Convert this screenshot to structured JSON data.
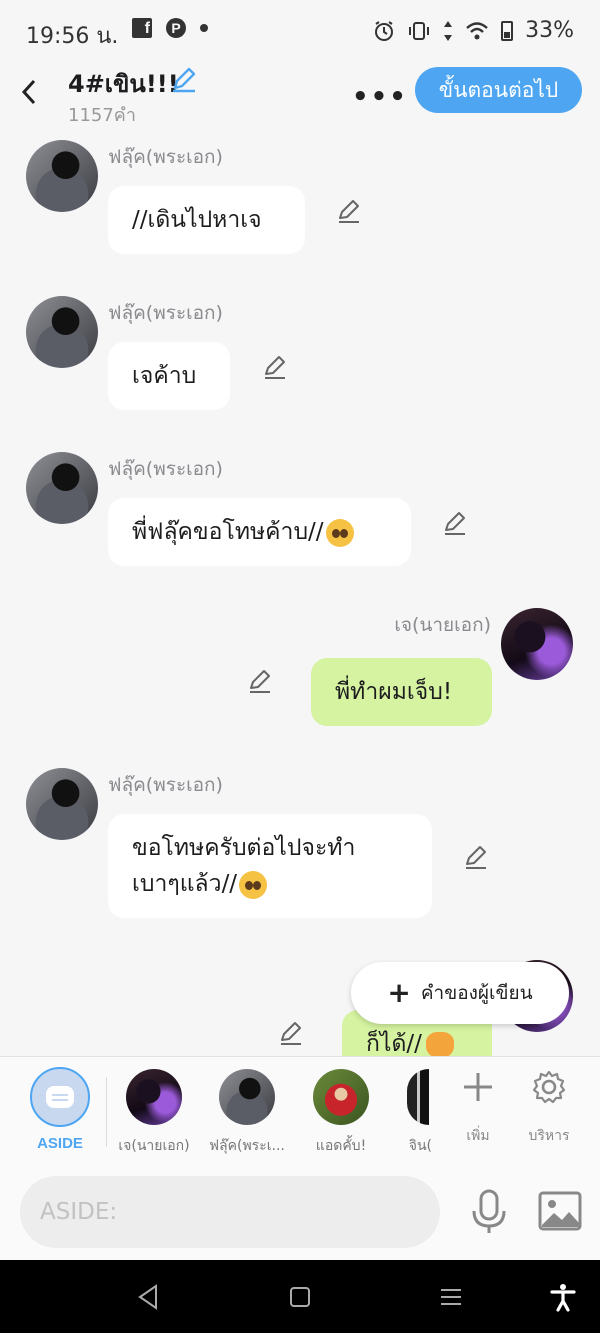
{
  "status_bar": {
    "time": "19:56 น.",
    "battery": "33%",
    "icons": [
      "facebook-icon",
      "pinterest-icon",
      "dot-icon",
      "alarm-icon",
      "vibrate-icon",
      "data-arrows-icon",
      "wifi-icon",
      "battery-icon"
    ]
  },
  "header": {
    "title": "4#เขิน!!!",
    "word_count": "1157คำ",
    "more_label": "•••",
    "next_button": "ขั้นตอนต่อไป"
  },
  "messages": [
    {
      "side": "left",
      "sender": "ฟลุ๊ค(พระเอก)",
      "text": "//เดินไปหาเจ"
    },
    {
      "side": "left",
      "sender": "ฟลุ๊ค(พระเอก)",
      "text": "เจค้าบ"
    },
    {
      "side": "left",
      "sender": "ฟลุ๊ค(พระเอก)",
      "text": "พี่ฟลุ๊คขอโทษค้าบ//",
      "emoji": "pleading-face-emoji"
    },
    {
      "side": "right",
      "sender": "เจ(นายเอก)",
      "text": "พี่ทำผมเจ็บ!"
    },
    {
      "side": "left",
      "sender": "ฟลุ๊ค(พระเอก)",
      "line1": "ขอโทษครับต่อไปจะทำ",
      "line2": "เบาๆแล้ว//",
      "emoji": "pleading-face-emoji"
    },
    {
      "side": "right",
      "sender": "",
      "text": "ก็ได้//",
      "emoji": "angry-cat-emoji"
    }
  ],
  "author_note": {
    "plus": "+",
    "label": "คำของผู้เขียน"
  },
  "picker": {
    "aside_label": "ASIDE",
    "characters": [
      "เจ(นายเอก)",
      "ฟลุ๊ค(พระเ...",
      "แอดคั้บ!",
      "จิน("
    ],
    "add_label": "เพิ่ม",
    "manage_label": "บริหาร"
  },
  "input": {
    "placeholder": "ASIDE:"
  }
}
